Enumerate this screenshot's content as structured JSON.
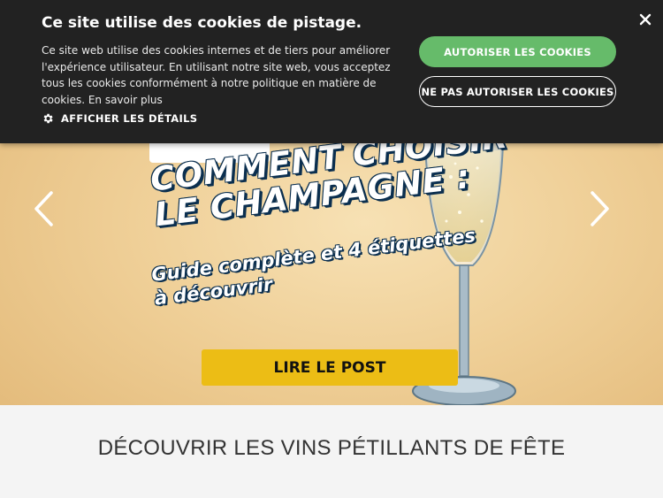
{
  "cookie_banner": {
    "title": "Ce site utilise des cookies de pistage.",
    "text": "Ce site web utilise des cookies internes et de tiers pour améliorer l'expérience utilisateur. En utilisant notre site web, vous acceptez tous les cookies conformément à notre politique en matière de cookies. En savoir plus",
    "details_label": "AFFICHER LES DÉTAILS",
    "allow_label": "AUTORISER LES COOKIES",
    "deny_label": "NE PAS AUTORISER LES COOKIES",
    "icons": {
      "details": "gear-icon",
      "close": "close-icon"
    },
    "colors": {
      "background": "#222222",
      "allow": "#66bb6a"
    }
  },
  "hero": {
    "headline_1": "COMMENT CHOISIR",
    "headline_2": "LE CHAMPAGNE :",
    "subtitle_1": "Guide complète et 4 étiquettes",
    "subtitle_2": "à découvrir",
    "cta_label": "LIRE LE POST",
    "icons": {
      "prev": "chevron-left-icon",
      "next": "chevron-right-icon"
    },
    "colors": {
      "cta": "#ecbd15",
      "headline_outline": "#0b2f4f"
    }
  },
  "section": {
    "title": "DÉCOUVRIR LES VINS PÉTILLANTS DE FÊTE"
  }
}
